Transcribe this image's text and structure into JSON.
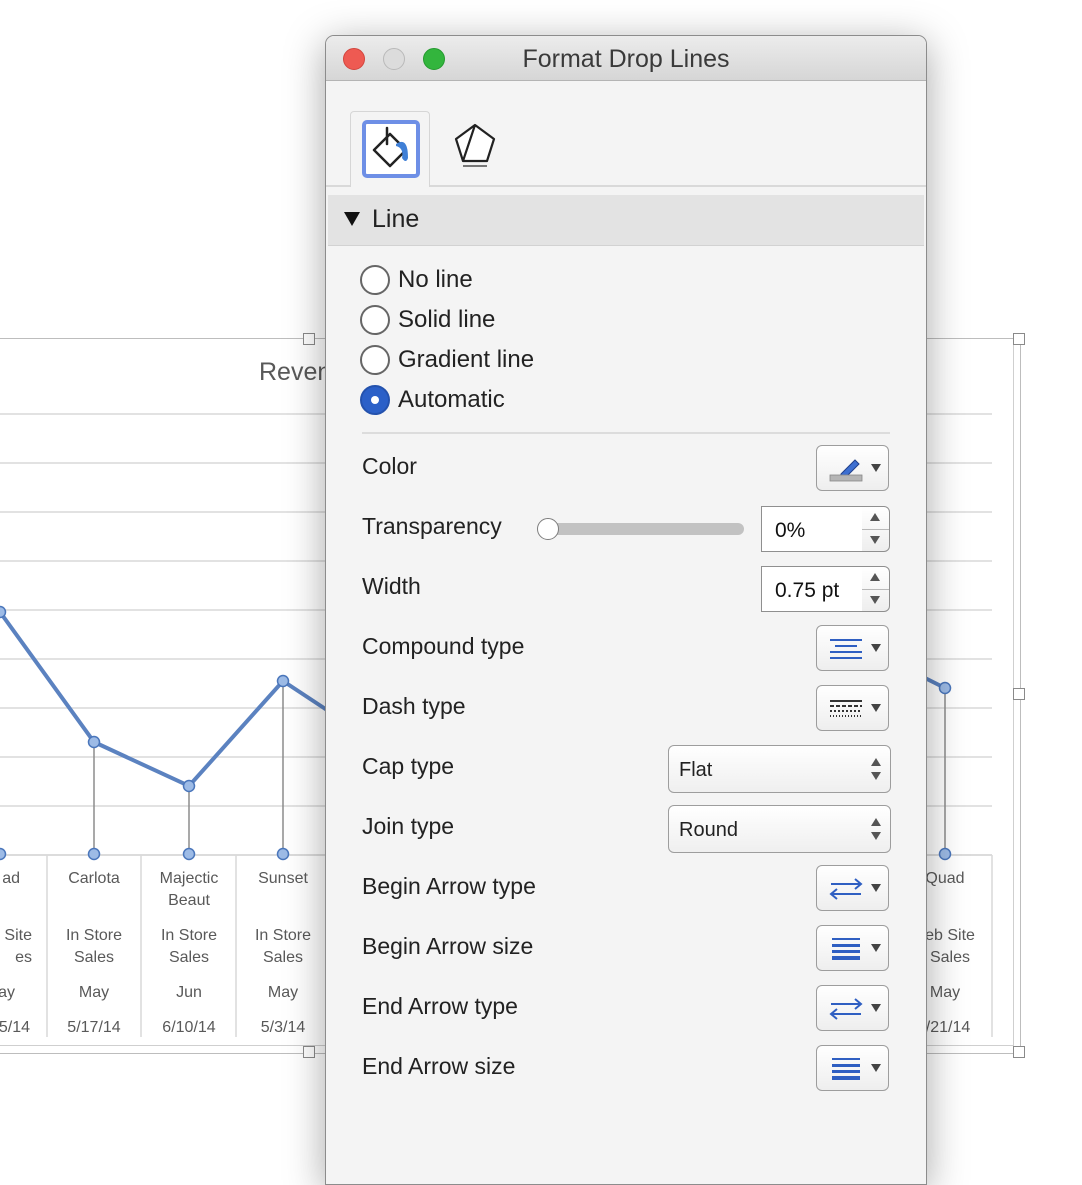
{
  "chart": {
    "title": "Reven",
    "categories": [
      {
        "name": "ad",
        "channel": "Site\nes",
        "month": "ay",
        "date": "5/14"
      },
      {
        "name": "Carlota",
        "channel": "In Store\nSales",
        "month": "May",
        "date": "5/17/14"
      },
      {
        "name": "Majectic\nBeaut",
        "channel": "In Store\nSales",
        "month": "Jun",
        "date": "6/10/14"
      },
      {
        "name": "Sunset",
        "channel": "In Store\nSales",
        "month": "May",
        "date": "5/3/14"
      },
      {
        "name": "Quad",
        "channel": "eb Site\nSales",
        "month": "May",
        "date": "/21/14"
      }
    ],
    "line_color": "#5b82c0"
  },
  "dialog": {
    "title": "Format Drop Lines",
    "tabs": [
      {
        "name": "fill-and-line",
        "icon": "paint-bucket-icon",
        "active": true
      },
      {
        "name": "effects",
        "icon": "pentagon-icon",
        "active": false
      }
    ],
    "section_title": "Line",
    "line_options": [
      {
        "label": "No line",
        "checked": false
      },
      {
        "label": "Solid line",
        "checked": false
      },
      {
        "label": "Gradient line",
        "checked": false
      },
      {
        "label": "Automatic",
        "checked": true
      }
    ],
    "props": {
      "color": {
        "label": "Color",
        "icon": "pen-color-icon"
      },
      "transparency": {
        "label": "Transparency",
        "value": "0%",
        "level": 0
      },
      "width": {
        "label": "Width",
        "value": "0.75 pt"
      },
      "compound_type": {
        "label": "Compound type",
        "icon": "compound-lines-icon"
      },
      "dash_type": {
        "label": "Dash type",
        "icon": "dash-lines-icon"
      },
      "cap_type": {
        "label": "Cap type",
        "value": "Flat"
      },
      "join_type": {
        "label": "Join type",
        "value": "Round"
      },
      "begin_arrow_type": {
        "label": "Begin Arrow type",
        "icon": "arrow-type-icon"
      },
      "begin_arrow_size": {
        "label": "Begin Arrow size",
        "icon": "arrow-size-icon"
      },
      "end_arrow_type": {
        "label": "End Arrow type",
        "icon": "arrow-type-icon"
      },
      "end_arrow_size": {
        "label": "End Arrow size",
        "icon": "arrow-size-icon"
      }
    },
    "accent_color": "#2b60c8"
  }
}
